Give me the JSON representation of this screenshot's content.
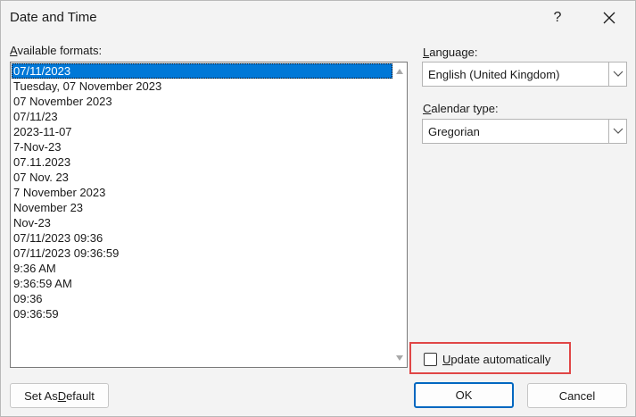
{
  "window": {
    "title": "Date and Time",
    "help_glyph": "?"
  },
  "formats": {
    "label": "Available formats:",
    "label_mnemonic": "A",
    "label_rest": "vailable formats:",
    "selected_index": 0,
    "items": [
      "07/11/2023",
      "Tuesday, 07 November 2023",
      "07 November 2023",
      "07/11/23",
      "2023-11-07",
      "7-Nov-23",
      "07.11.2023",
      "07 Nov. 23",
      "7 November 2023",
      "November 23",
      "Nov-23",
      "07/11/2023 09:36",
      "07/11/2023 09:36:59",
      "9:36 AM",
      "9:36:59 AM",
      "09:36",
      "09:36:59"
    ]
  },
  "language": {
    "label_mnemonic": "L",
    "label_rest": "anguage:",
    "value": "English (United Kingdom)"
  },
  "calendar": {
    "label_mnemonic": "C",
    "label_rest": "alendar type:",
    "value": "Gregorian"
  },
  "update": {
    "label_mnemonic": "U",
    "label_rest": "pdate automatically",
    "checked": false,
    "highlight_color": "#e04646"
  },
  "buttons": {
    "set_default_prefix": "Set As ",
    "set_default_mnemonic": "D",
    "set_default_rest": "efault",
    "ok": "OK",
    "cancel": "Cancel"
  },
  "colors": {
    "accent": "#0078d7",
    "default_button_border": "#0067c0"
  }
}
